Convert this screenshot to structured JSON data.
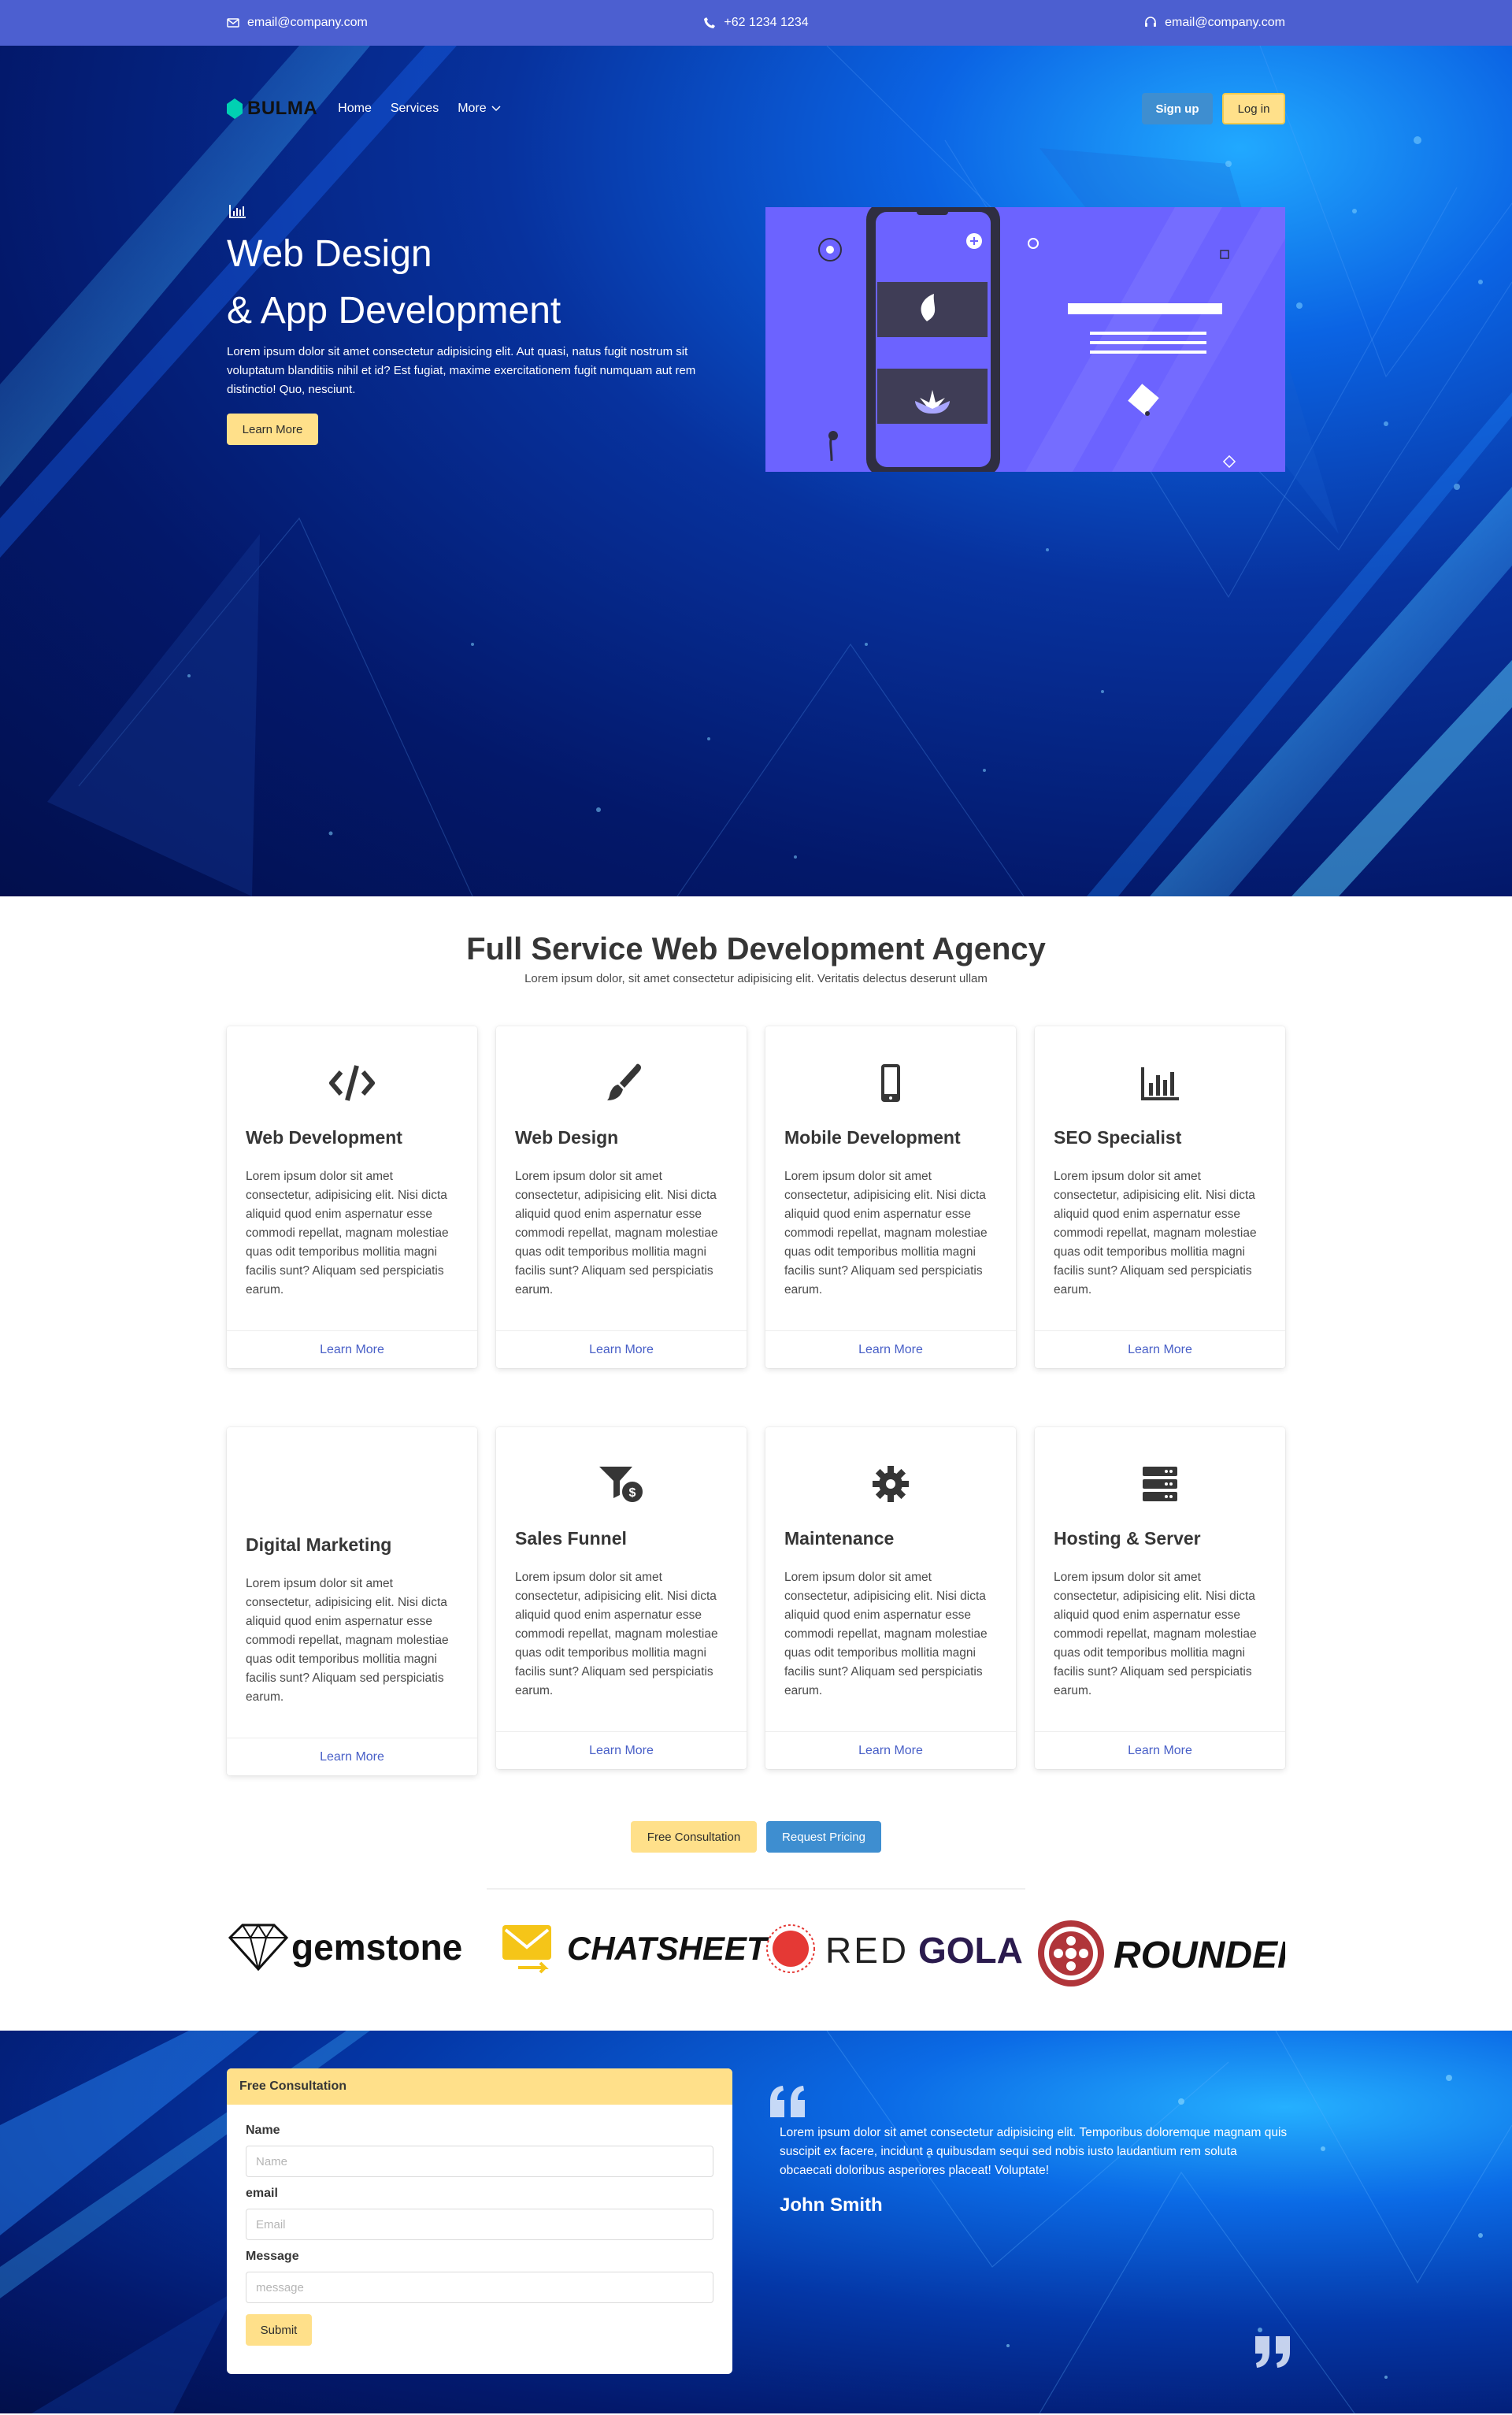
{
  "topbar": {
    "email_left": "email@company.com",
    "phone": "+62 1234 1234",
    "email_right": "email@company.com"
  },
  "nav": {
    "logo_text": "BULMA",
    "links": [
      "Home",
      "Services",
      "More"
    ],
    "signup": "Sign up",
    "login": "Log in"
  },
  "hero": {
    "title_line1": "Web Design",
    "title_line2": "& App Development",
    "text": "Lorem ipsum dolor sit amet consectetur adipisicing elit. Aut quasi, natus fugit nostrum sit voluptatum blanditiis nihil et id? Est fugiat, maxime exercitationem fugit numquam aut rem distinctio! Quo, nesciunt.",
    "button": "Learn More"
  },
  "services": {
    "title": "Full Service Web Development Agency",
    "subtitle": "Lorem ipsum dolor, sit amet consectetur adipisicing elit. Veritatis delectus deserunt ullam",
    "card_text": "Lorem ipsum dolor sit amet consectetur, adipisicing elit. Nisi dicta aliquid quod enim aspernatur esse commodi repellat, magnam molestiae quas odit temporibus mollitia magni facilis sunt? Aliquam sed perspiciatis earum.",
    "card_link": "Learn More",
    "cards": [
      {
        "title": "Web Development",
        "icon": "code-icon"
      },
      {
        "title": "Web Design",
        "icon": "paint-brush-icon"
      },
      {
        "title": "Mobile Development",
        "icon": "mobile-icon"
      },
      {
        "title": "SEO Specialist",
        "icon": "chart-bar-icon"
      },
      {
        "title": "Digital Marketing",
        "icon": ""
      },
      {
        "title": "Sales Funnel",
        "icon": "funnel-dollar-icon"
      },
      {
        "title": "Maintenance",
        "icon": "cog-icon"
      },
      {
        "title": "Hosting & Server",
        "icon": "server-icon"
      }
    ]
  },
  "cta": {
    "consult": "Free Consultation",
    "pricing": "Request Pricing"
  },
  "brands": [
    "gemstone",
    "CHATSHEET",
    "RED",
    "GOLA",
    "ROUNDER"
  ],
  "form": {
    "title": "Free Consultation",
    "name_label": "Name",
    "name_placeholder": "Name",
    "email_label": "email",
    "email_placeholder": "Email",
    "message_label": "Message",
    "message_placeholder": "message",
    "submit": "Submit"
  },
  "testimonial": {
    "text": "Lorem ipsum dolor sit amet consectetur adipisicing elit. Temporibus doloremque magnam quis suscipit ex facere, incidunt a quibusdam sequi sed nobis iusto laudantium rem soluta obcaecati doloribus asperiores placeat! Voluptate!",
    "author": "John Smith"
  },
  "colors": {
    "topbar": "#4c5fd0",
    "primary_link": "#485fc7",
    "yellow": "#ffe08a",
    "info_blue": "#3e8ed0",
    "illustration": "#6c63ff"
  }
}
